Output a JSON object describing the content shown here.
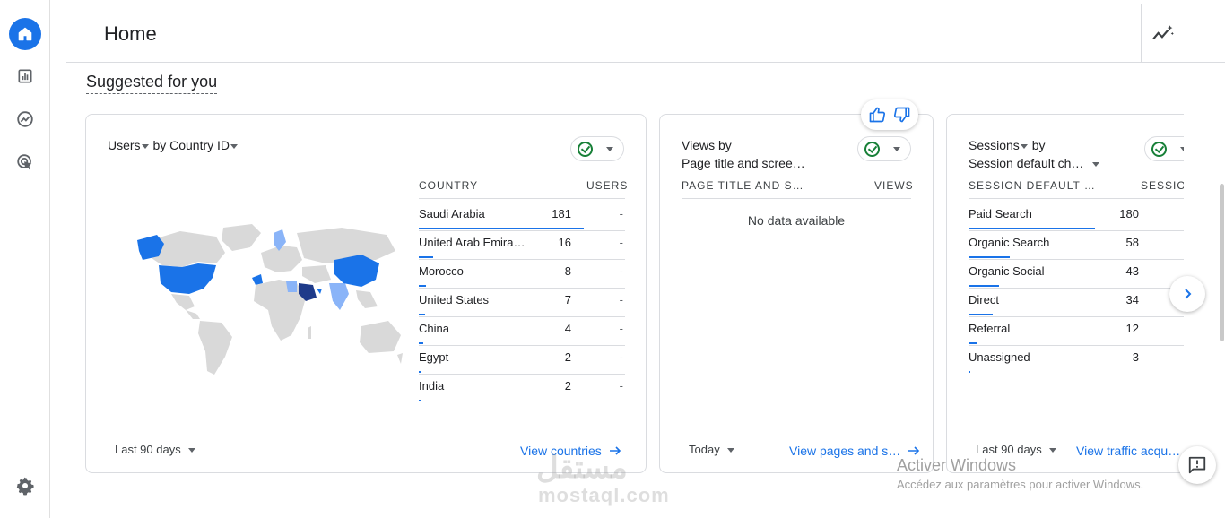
{
  "header": {
    "title": "Home"
  },
  "section": {
    "title": "Suggested for you"
  },
  "cards": [
    {
      "title_metric": "Users",
      "title_by": "by Country ID",
      "col_dimension": "COUNTRY",
      "col_metric": "USERS",
      "rows": [
        {
          "name": "Saudi Arabia",
          "value": "181",
          "extra": "-"
        },
        {
          "name": "United Arab Emira…",
          "value": "16",
          "extra": "-"
        },
        {
          "name": "Morocco",
          "value": "8",
          "extra": "-"
        },
        {
          "name": "United States",
          "value": "7",
          "extra": "-"
        },
        {
          "name": "China",
          "value": "4",
          "extra": "-"
        },
        {
          "name": "Egypt",
          "value": "2",
          "extra": "-"
        },
        {
          "name": "India",
          "value": "2",
          "extra": "-"
        }
      ],
      "date_range": "Last 90 days",
      "link": "View countries"
    },
    {
      "title_line1": "Views by",
      "title_line2": "Page title and scree…",
      "col_dimension": "PAGE TITLE AND S…",
      "col_metric": "VIEWS",
      "empty_message": "No data available",
      "date_range": "Today",
      "link": "View pages and s…"
    },
    {
      "title_metric": "Sessions",
      "title_by": "by",
      "title_line2": "Session default ch…",
      "col_dimension": "SESSION DEFAULT …",
      "col_metric": "SESSIO",
      "rows": [
        {
          "name": "Paid Search",
          "value": "180"
        },
        {
          "name": "Organic Search",
          "value": "58"
        },
        {
          "name": "Organic Social",
          "value": "43"
        },
        {
          "name": "Direct",
          "value": "34"
        },
        {
          "name": "Referral",
          "value": "12"
        },
        {
          "name": "Unassigned",
          "value": "3"
        }
      ],
      "date_range": "Last 90 days",
      "link": "View traffic acqu…"
    }
  ],
  "watermark": {
    "line1": "Activer Windows",
    "line2": "Accédez aux paramètres pour activer Windows."
  },
  "overlay_logo": {
    "mark": "مستقل",
    "sub": "mostaql.com"
  },
  "colors": {
    "accent": "#1a73e8",
    "success": "#188038",
    "map_land": "#d9d9d9",
    "map_high": "#1e3a8a"
  },
  "icons": [
    "home-icon",
    "reports-icon",
    "explore-icon",
    "advertising-icon",
    "settings-icon",
    "insights-icon",
    "thumbs-up-icon",
    "thumbs-down-icon",
    "chevron-right-icon",
    "feedback-icon",
    "arrow-right-icon"
  ]
}
